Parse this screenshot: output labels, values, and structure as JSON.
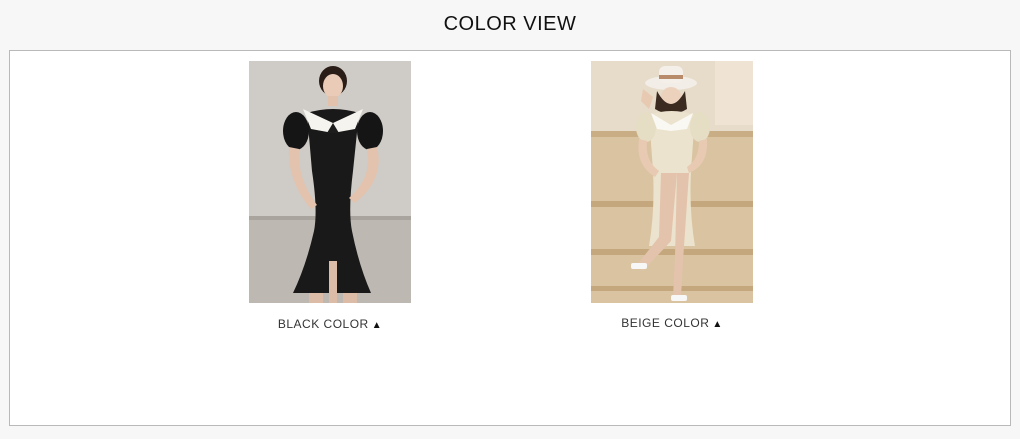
{
  "section": {
    "title": "COLOR VIEW"
  },
  "colors": [
    {
      "label": "BLACK COLOR",
      "marker": "▲",
      "swatch": "#1a1a1a",
      "image": "model-black-dress"
    },
    {
      "label": "BEIGE COLOR",
      "marker": "▲",
      "swatch": "#e6dcc3",
      "image": "model-beige-dress"
    }
  ],
  "palette": {
    "background": "#f7f7f7",
    "frame": "#ffffff",
    "border": "#b9b9b9"
  }
}
